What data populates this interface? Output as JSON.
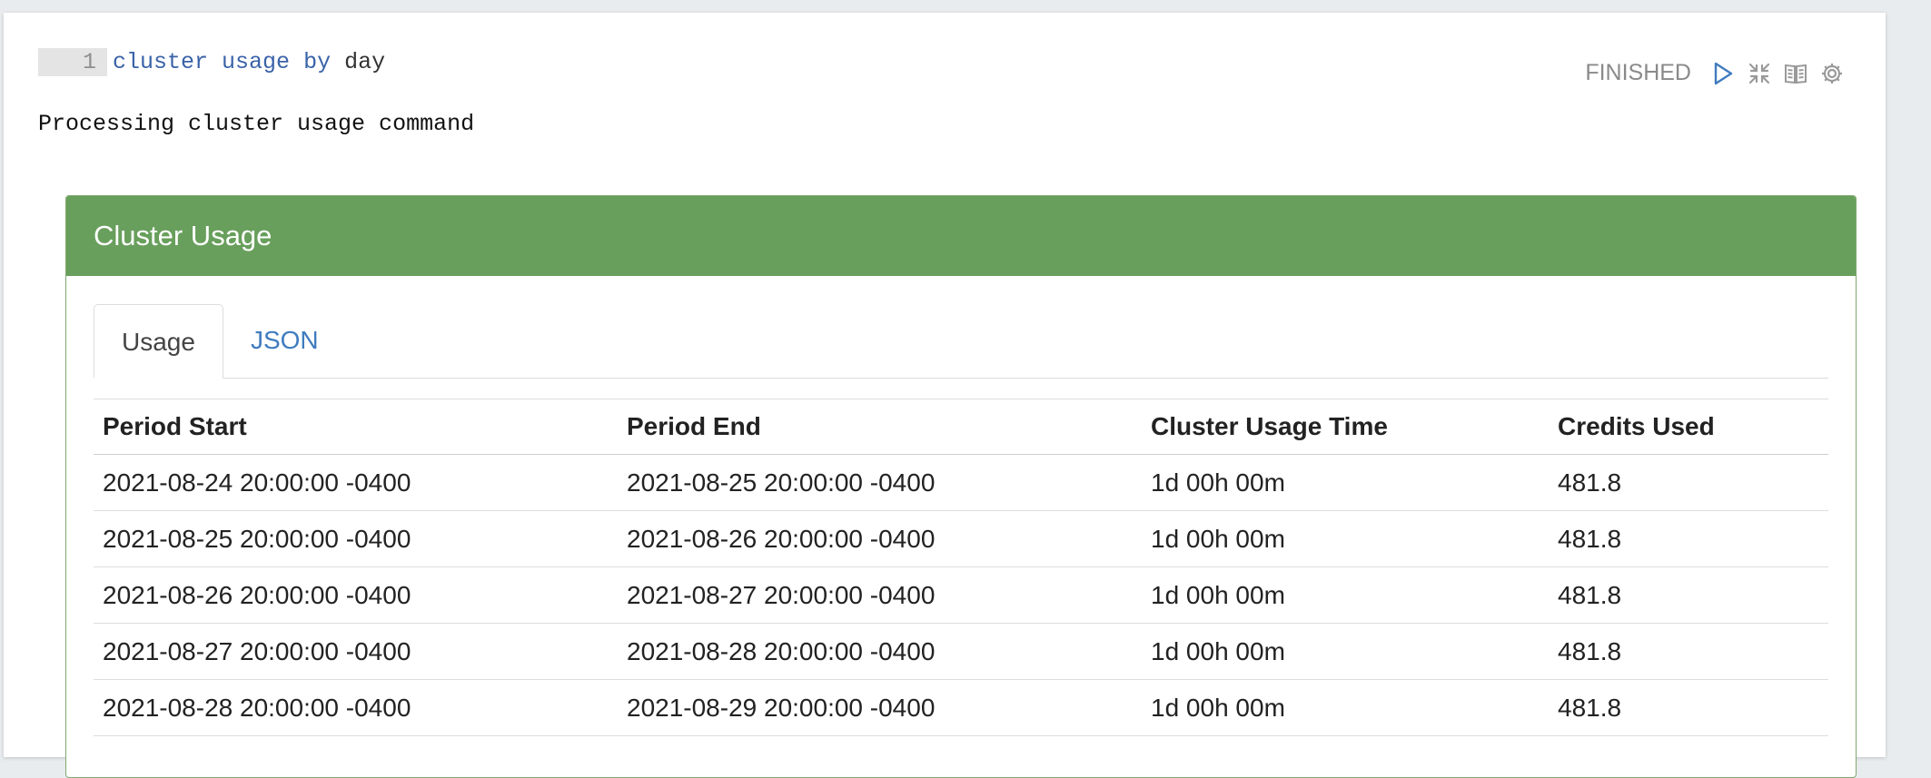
{
  "editor": {
    "line_number": "1",
    "tokens": [
      "cluster",
      "usage",
      "by",
      "day"
    ]
  },
  "status": {
    "text": "FINISHED",
    "icons": [
      "play-icon",
      "collapse-icon",
      "book-icon",
      "gear-icon"
    ],
    "icon_color": "#3f7bbf"
  },
  "output": {
    "message": "Processing cluster usage command"
  },
  "panel": {
    "title": "Cluster Usage",
    "header_color": "#689f5c",
    "tabs": [
      {
        "label": "Usage",
        "active": true
      },
      {
        "label": "JSON",
        "active": false
      }
    ]
  },
  "table": {
    "headers": [
      "Period Start",
      "Period End",
      "Cluster Usage Time",
      "Credits Used"
    ],
    "rows": [
      [
        "2021-08-24 20:00:00 -0400",
        "2021-08-25 20:00:00 -0400",
        "1d 00h 00m",
        "481.8"
      ],
      [
        "2021-08-25 20:00:00 -0400",
        "2021-08-26 20:00:00 -0400",
        "1d 00h 00m",
        "481.8"
      ],
      [
        "2021-08-26 20:00:00 -0400",
        "2021-08-27 20:00:00 -0400",
        "1d 00h 00m",
        "481.8"
      ],
      [
        "2021-08-27 20:00:00 -0400",
        "2021-08-28 20:00:00 -0400",
        "1d 00h 00m",
        "481.8"
      ],
      [
        "2021-08-28 20:00:00 -0400",
        "2021-08-29 20:00:00 -0400",
        "1d 00h 00m",
        "481.8"
      ]
    ]
  }
}
